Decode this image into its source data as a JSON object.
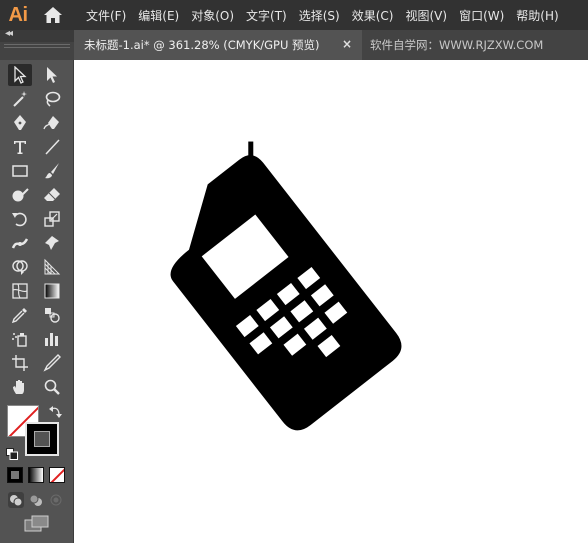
{
  "app": {
    "logo": "Ai"
  },
  "menu": [
    "文件(F)",
    "编辑(E)",
    "对象(O)",
    "文字(T)",
    "选择(S)",
    "效果(C)",
    "视图(V)",
    "窗口(W)",
    "帮助(H)"
  ],
  "tabs": {
    "active": "未标题-1.ai* @ 361.28% (CMYK/GPU 预览)",
    "close": "×",
    "inactive": "软件自学网：WWW.RJZXW.COM"
  },
  "colors": {
    "accent": "#f39a47",
    "menubar": "#323232",
    "panel": "#535353",
    "canvas": "#ffffff",
    "artwork": "#000000"
  },
  "tool_icons": [
    "selection-tool-icon",
    "direct-selection-tool-icon",
    "magic-wand-tool-icon",
    "lasso-tool-icon",
    "pen-tool-icon",
    "curvature-tool-icon",
    "type-tool-icon",
    "line-segment-tool-icon",
    "rectangle-tool-icon",
    "paintbrush-tool-icon",
    "shaper-tool-icon",
    "eraser-tool-icon",
    "rotate-tool-icon",
    "scale-tool-icon",
    "width-tool-icon",
    "puppet-warp-tool-icon",
    "shape-builder-tool-icon",
    "perspective-grid-tool-icon",
    "mesh-tool-icon",
    "gradient-tool-icon",
    "eyedropper-tool-icon",
    "blend-tool-icon",
    "symbol-sprayer-tool-icon",
    "column-graph-tool-icon",
    "artboard-tool-icon",
    "slice-tool-icon",
    "hand-tool-icon",
    "zoom-tool-icon"
  ],
  "fill_stroke": {
    "fill": "none",
    "stroke": "#000000"
  }
}
